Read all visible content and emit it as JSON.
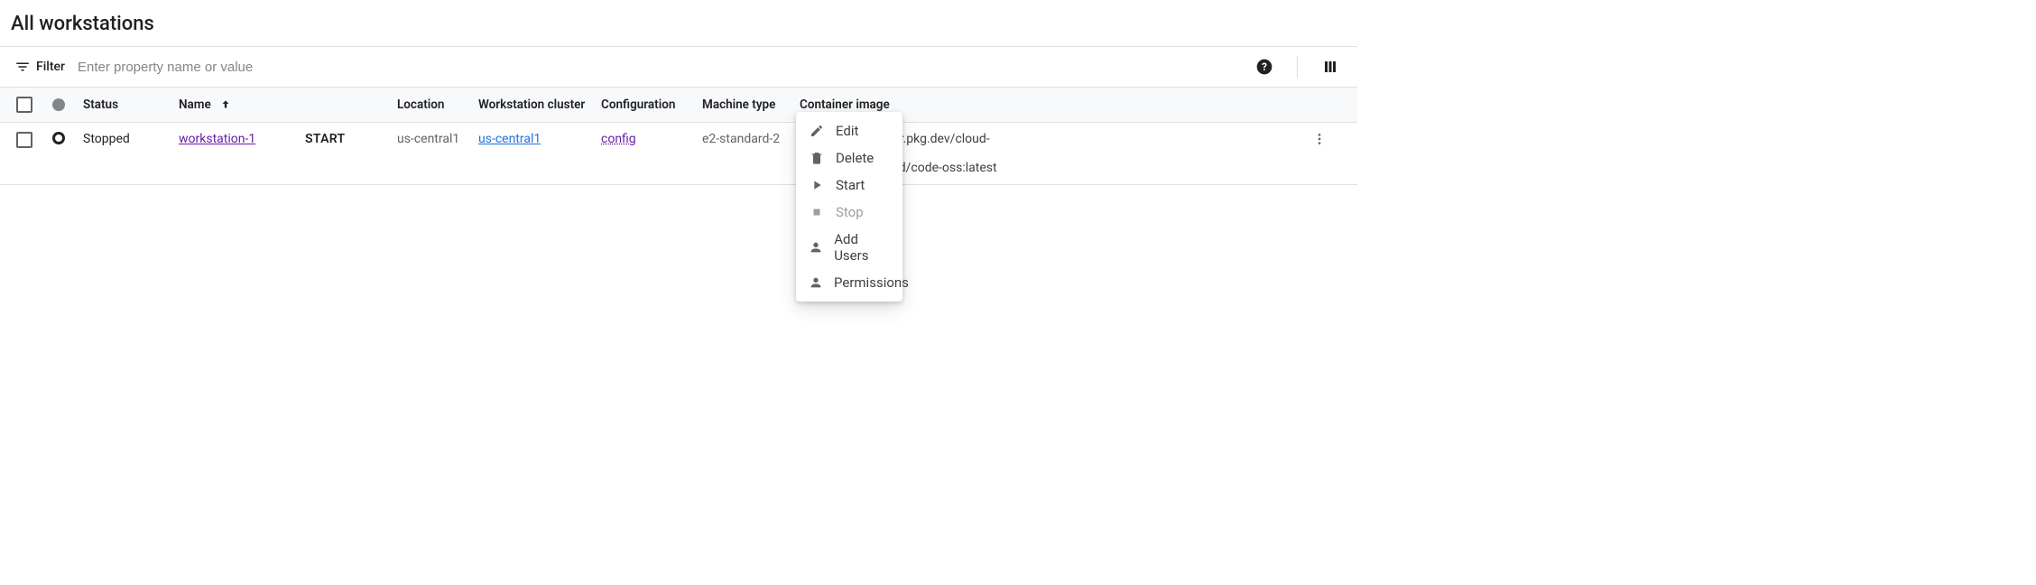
{
  "page": {
    "title": "All workstations"
  },
  "filter": {
    "label": "Filter",
    "placeholder": "Enter property name or value"
  },
  "columns": {
    "status": "Status",
    "name": "Name",
    "location": "Location",
    "cluster": "Workstation cluster",
    "configuration": "Configuration",
    "machine_type": "Machine type",
    "container_image": "Container image"
  },
  "rows": [
    {
      "status": "Stopped",
      "name": "workstation-1",
      "action": "START",
      "location": "us-central1",
      "cluster": "us-central1",
      "configuration": "config",
      "machine_type": "e2-standard-2",
      "container_image": "us-central1-docker.pkg.dev/cloud-workstations-images/predefined/code-oss:latest"
    }
  ],
  "menu": {
    "edit": "Edit",
    "delete": "Delete",
    "start": "Start",
    "stop": "Stop",
    "add_users": "Add Users",
    "permissions": "Permissions"
  }
}
